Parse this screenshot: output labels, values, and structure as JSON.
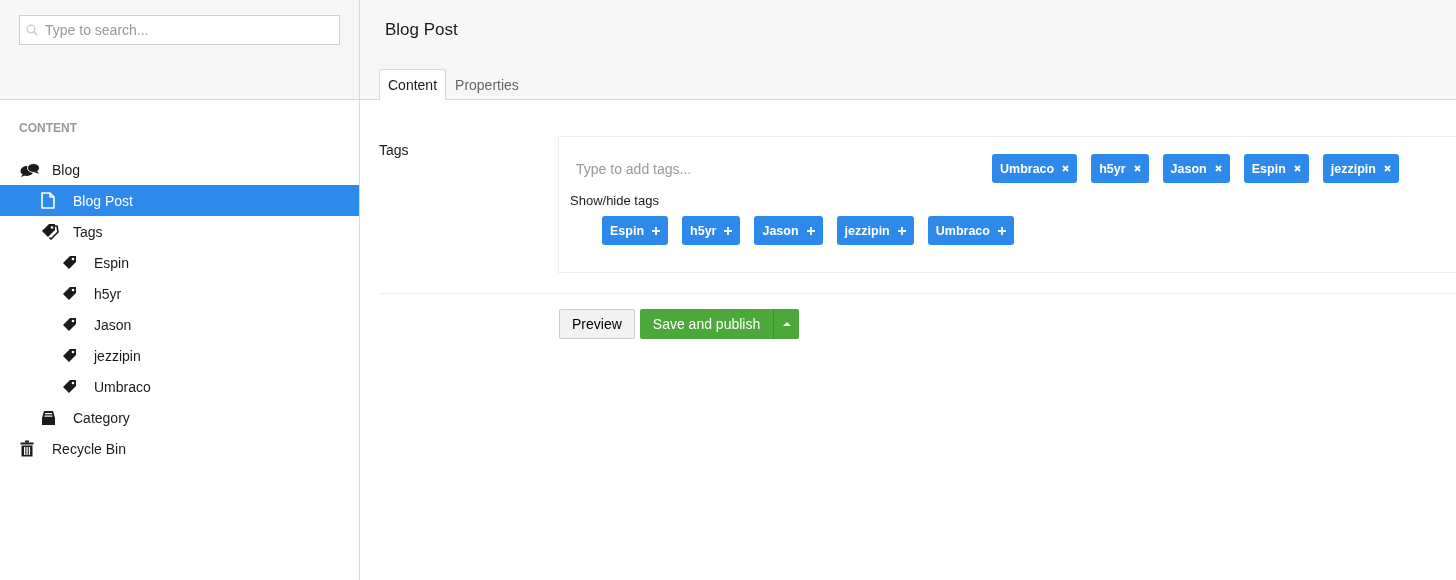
{
  "search": {
    "placeholder": "Type to search..."
  },
  "sidebar": {
    "section_title": "CONTENT",
    "tree": [
      {
        "label": "Blog",
        "kind": "blog",
        "selected": false,
        "children": [
          {
            "label": "Blog Post",
            "kind": "post",
            "selected": true
          },
          {
            "label": "Tags",
            "kind": "tag-folder",
            "selected": false,
            "children": [
              {
                "label": "Espin",
                "kind": "tag",
                "selected": false
              },
              {
                "label": "h5yr",
                "kind": "tag",
                "selected": false
              },
              {
                "label": "Jason",
                "kind": "tag",
                "selected": false
              },
              {
                "label": "jezzipin",
                "kind": "tag",
                "selected": false
              },
              {
                "label": "Umbraco",
                "kind": "tag",
                "selected": false
              }
            ]
          },
          {
            "label": "Category",
            "kind": "category",
            "selected": false
          }
        ]
      },
      {
        "label": "Recycle Bin",
        "kind": "recycle-bin",
        "selected": false
      }
    ]
  },
  "editor": {
    "title": "Blog Post",
    "tabs": [
      {
        "label": "Content",
        "selected": true
      },
      {
        "label": "Properties",
        "selected": false
      }
    ],
    "property_label": "Tags",
    "tag_input": {
      "placeholder": "Type to add tags..."
    },
    "selected_tags": [
      "Umbraco",
      "h5yr",
      "Jason",
      "Espin",
      "jezzipin"
    ],
    "toggle_label": "Show/hide tags",
    "available_tags": [
      "Espin",
      "h5yr",
      "Jason",
      "jezzipin",
      "Umbraco"
    ],
    "buttons": {
      "preview": "Preview",
      "publish": "Save and publish"
    }
  }
}
